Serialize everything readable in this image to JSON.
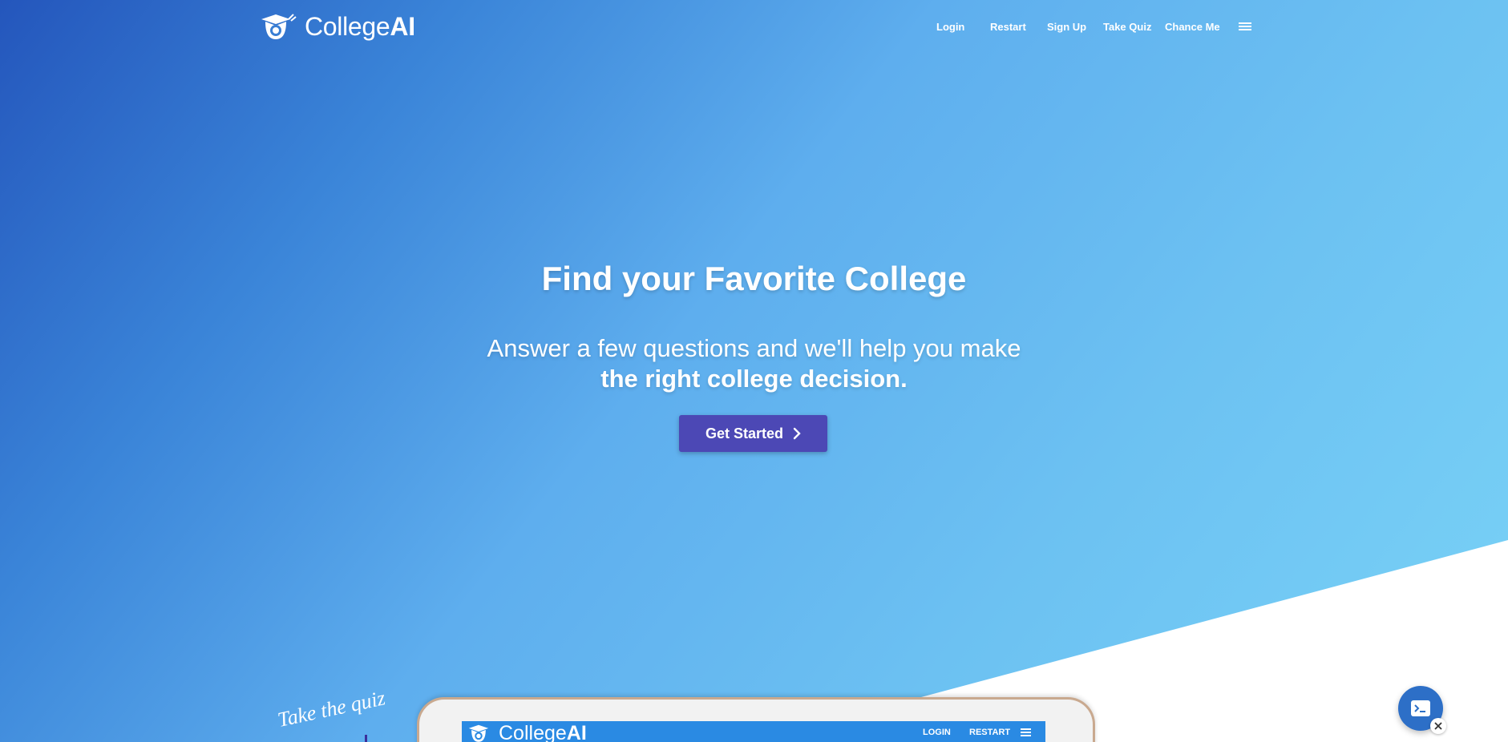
{
  "header": {
    "brand_light": "College",
    "brand_bold": "AI",
    "nav": [
      {
        "label": "Login"
      },
      {
        "label": "Restart"
      },
      {
        "label": "Sign Up"
      },
      {
        "label": "Take Quiz"
      },
      {
        "label": "Chance Me"
      }
    ],
    "menu_icon": "hamburger-menu-icon",
    "logo_icon": "graduation-cap-logo-icon"
  },
  "hero": {
    "title": "Find your Favorite College",
    "subtitle_line1": "Answer a few questions and we'll help you make",
    "subtitle_line2": "the right college decision.",
    "cta_label": "Get Started",
    "cta_icon": "chevron-right-icon"
  },
  "preview": {
    "annotation": "Take the quiz",
    "brand_light": "College",
    "brand_bold": "AI",
    "nav": [
      {
        "label": "LOGIN"
      },
      {
        "label": "RESTART"
      }
    ]
  },
  "chat_widget": {
    "icon": "terminal-chat-icon",
    "close_icon": "close-icon"
  },
  "colors": {
    "hero_gradient_start": "#2456bc",
    "hero_gradient_end": "#79d2f6",
    "cta_background": "#4c48b5",
    "preview_header": "#2a8ae3",
    "chat_button": "#2d6fc7"
  }
}
